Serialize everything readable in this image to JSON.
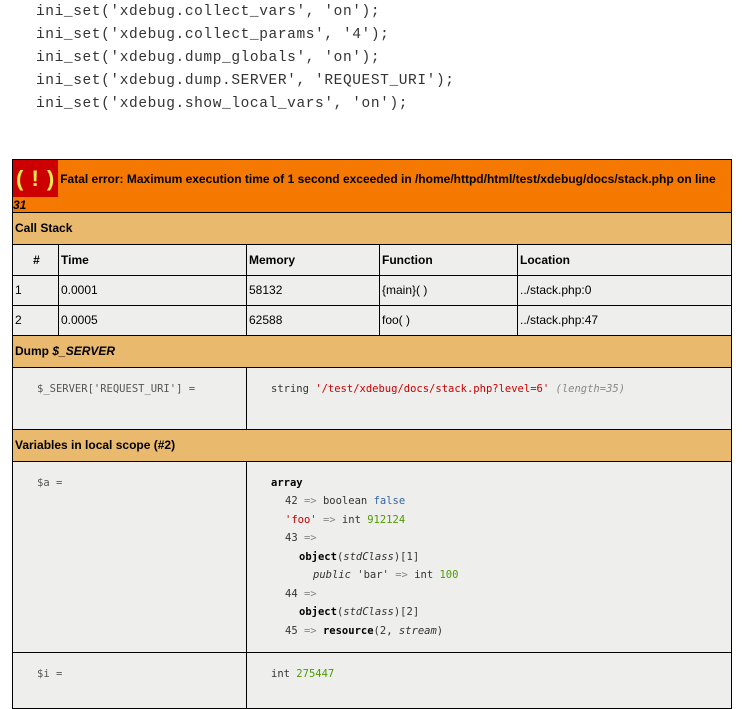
{
  "code_lines": [
    "ini_set('xdebug.collect_vars', 'on');",
    "ini_set('xdebug.collect_params', '4');",
    "ini_set('xdebug.dump_globals', 'on');",
    "ini_set('xdebug.dump.SERVER', 'REQUEST_URI');",
    "ini_set('xdebug.show_local_vars', 'on');"
  ],
  "error": {
    "icon_text": "( ! )",
    "message": "Fatal error: Maximum execution time of 1 second exceeded in /home/httpd/html/test/xdebug/docs/stack.php on line ",
    "line": "31"
  },
  "call_stack": {
    "title": "Call Stack",
    "columns": [
      "#",
      "Time",
      "Memory",
      "Function",
      "Location"
    ],
    "rows": [
      [
        "1",
        "0.0001",
        "58132",
        "{main}( )",
        "../stack.php:0"
      ],
      [
        "2",
        "0.0005",
        "62588",
        "foo( )",
        "../stack.php:47"
      ]
    ]
  },
  "dump_server": {
    "title_prefix": "Dump ",
    "title_var": "$_SERVER",
    "name": "$_SERVER['REQUEST_URI'] =",
    "type": "string",
    "value": "'/test/xdebug/docs/stack.php?level=6'",
    "length": "(length=35)"
  },
  "local_scope": {
    "title": "Variables in local scope (#2)",
    "var_a": {
      "name": "$a =",
      "lines": {
        "array": "array",
        "k42": "42",
        "arrow": "=>",
        "boolean": "boolean",
        "false": "false",
        "kfoo": "'foo'",
        "int": "int",
        "v912124": "912124",
        "k43": "43",
        "object": "object",
        "stdclass": "stdClass",
        "n1": "[1]",
        "public": "public",
        "kbar": "'bar'",
        "v100": "100",
        "k44": "44",
        "n2": "[2]",
        "k45": "45",
        "resource": "resource",
        "res_open": "(",
        "res_num": "2",
        "res_comma": ", ",
        "stream": "stream",
        "res_close": ")",
        "paren_open": "(",
        "paren_close": ")"
      }
    },
    "var_i": {
      "name": "$i =",
      "type": "int",
      "value": "275447"
    }
  }
}
